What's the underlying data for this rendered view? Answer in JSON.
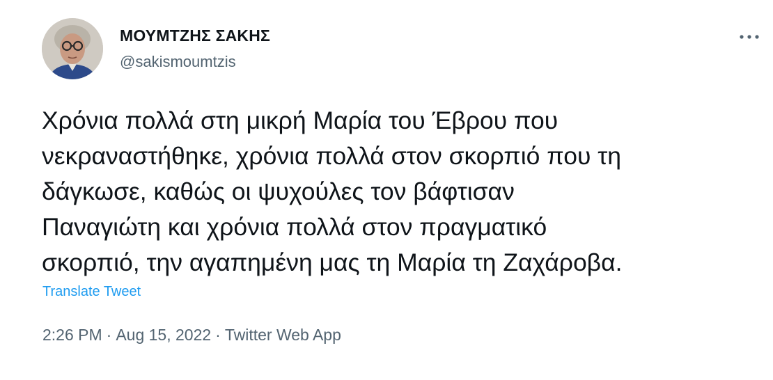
{
  "author": {
    "display_name": "ΜΟΥΜΤΖΗΣ ΣΑΚΗΣ",
    "handle": "@sakismoumtzis",
    "avatar_icon": "profile-photo"
  },
  "menu": {
    "icon": "more-horizontal-icon"
  },
  "tweet": {
    "text_lines": [
      "Χρόνια πολλά στη μικρή Μαρία του Έβρου που",
      "νεκραναστήθηκε, χρόνια πολλά στον σκορπιό που τη",
      "δάγκωσε, καθώς οι ψυχούλες τον βάφτισαν",
      "Παναγιώτη και χρόνια πολλά στον πραγματικό",
      "σκορπιό, την αγαπημένη μας τη Μαρία τη Ζαχάροβα."
    ],
    "translate_label": "Translate Tweet"
  },
  "meta": {
    "time": "2:26 PM",
    "date": "Aug 15, 2022",
    "source": "Twitter Web App",
    "separator": "·"
  },
  "colors": {
    "text": "#0f1419",
    "secondary": "#536471",
    "link": "#1d9bf0"
  }
}
